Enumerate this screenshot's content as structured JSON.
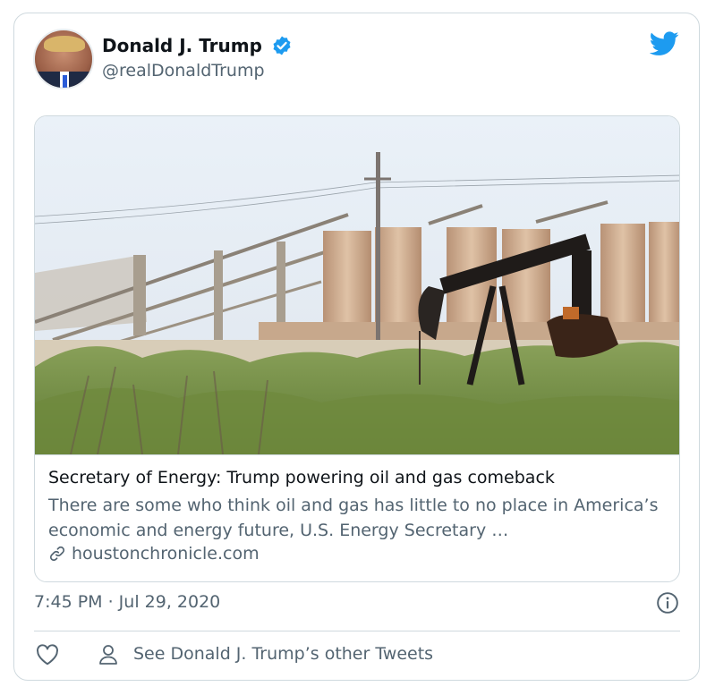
{
  "tweet": {
    "author_name": "Donald J. Trump",
    "handle": "@realDonaldTrump",
    "timestamp": "7:45 PM · Jul 29, 2020"
  },
  "link_card": {
    "title": "Secretary of Energy: Trump powering oil and gas comeback",
    "description": "There are some who think oil and gas has little to no place in America’s economic and energy future, U.S. Energy Secretary …",
    "domain": "houstonchronicle.com"
  },
  "footer": {
    "other_tweets_label": "See Donald J. Trump’s other Tweets"
  },
  "colors": {
    "accent": "#1d9bf0",
    "text_primary": "#0f1419",
    "text_secondary": "#536471",
    "border": "#cfd9de"
  },
  "icons": [
    "verified-badge-icon",
    "twitter-bird-icon",
    "link-icon",
    "info-icon",
    "heart-icon",
    "person-icon"
  ]
}
